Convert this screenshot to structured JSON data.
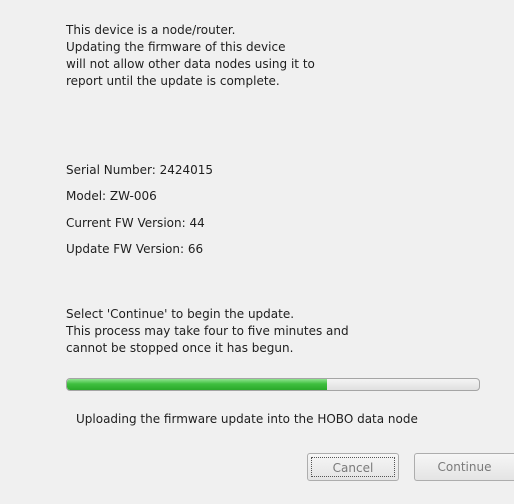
{
  "dialog": {
    "warning": "This device is a node/router.\nUpdating the firmware of this device\nwill not allow other data nodes using it to\nreport until the update is complete.",
    "serial_number": "Serial Number: 2424015",
    "model": "Model: ZW-006",
    "current_fw": "Current FW Version: 44",
    "update_fw": "Update FW Version: 66",
    "instructions": "Select 'Continue' to begin the update.\nThis process may take four to five minutes and\ncannot be stopped once it has begun.",
    "progress_fraction": 0.63,
    "status": "Uploading the firmware update into the HOBO data node",
    "cancel_label": "Cancel",
    "continue_label": "Continue"
  },
  "colors": {
    "progress_fill": "#3fbf3f",
    "background": "#f0f0f0"
  }
}
